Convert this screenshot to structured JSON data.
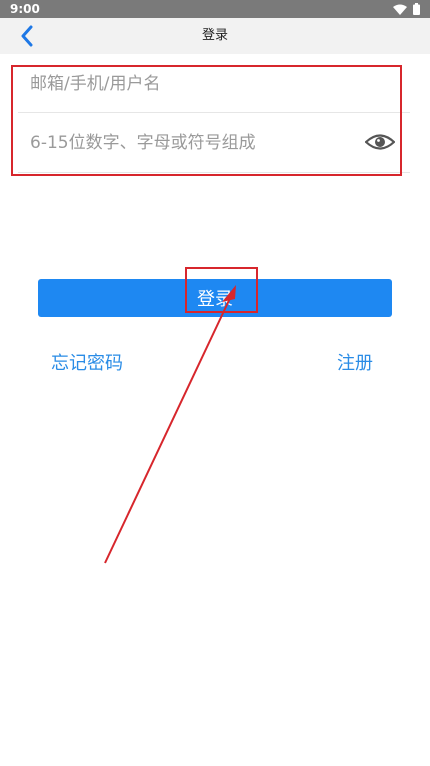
{
  "status_bar": {
    "time": "9:00",
    "wifi_icon": "wifi-icon",
    "battery_icon": "battery-icon"
  },
  "nav": {
    "back_icon": "chevron-left-icon",
    "title": "登录"
  },
  "form": {
    "username_placeholder": "邮箱/手机/用户名",
    "password_placeholder": "6-15位数字、字母或符号组成",
    "toggle_icon": "eye-icon"
  },
  "actions": {
    "login_label": "登录",
    "forgot_password": "忘记密码",
    "register": "注册"
  },
  "annotations": {
    "highlight_color": "#d7262c",
    "accent_color": "#1e88f2",
    "link_color": "#2a8ce6"
  }
}
